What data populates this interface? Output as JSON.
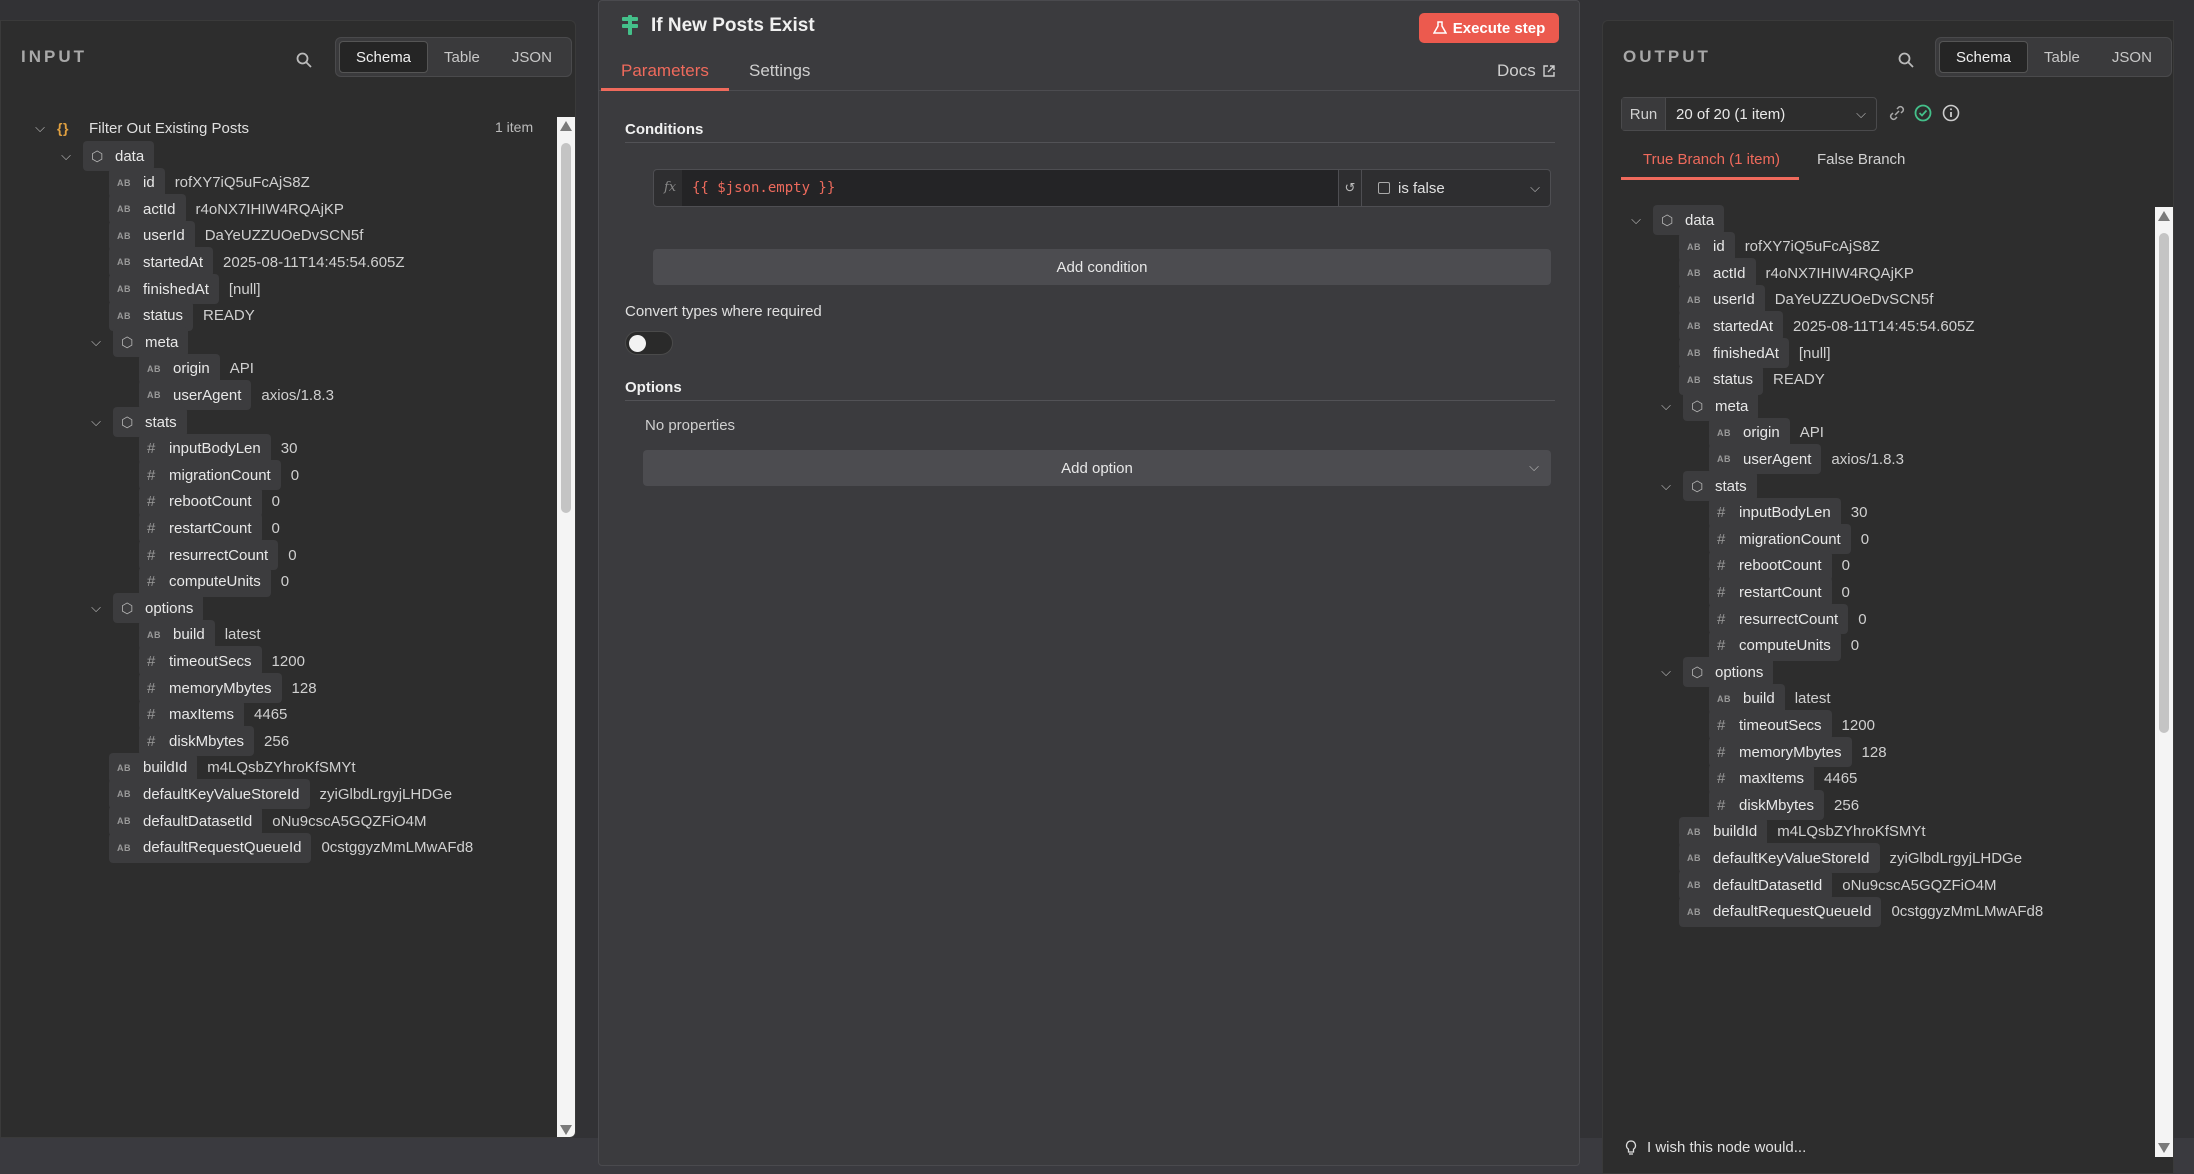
{
  "input": {
    "header": "INPUT",
    "tabs": [
      "Schema",
      "Table",
      "JSON"
    ],
    "root_title": "Filter Out Existing Posts",
    "root_count": "1 item"
  },
  "center": {
    "title": "If New Posts Exist",
    "execute_label": "Execute step",
    "tabs": [
      "Parameters",
      "Settings"
    ],
    "docs_label": "Docs",
    "conditions_label": "Conditions",
    "expression": "{{ $json.empty }}",
    "operator": "is false",
    "add_condition": "Add condition",
    "convert_label": "Convert types where required",
    "options_label": "Options",
    "no_properties": "No properties",
    "add_option": "Add option"
  },
  "output": {
    "header": "OUTPUT",
    "tabs": [
      "Schema",
      "Table",
      "JSON"
    ],
    "run_label": "Run",
    "run_value": "20 of 20 (1 item)",
    "branch_true": "True Branch (1 item)",
    "branch_false": "False Branch",
    "wish": "I wish this node would..."
  },
  "colors": {
    "accent": "#ef6a5c",
    "success": "#44c08a"
  },
  "tree": [
    {
      "d": 0,
      "t": "obj",
      "k": "data"
    },
    {
      "d": 1,
      "t": "str",
      "k": "id",
      "v": "rofXY7iQ5uFcAjS8Z"
    },
    {
      "d": 1,
      "t": "str",
      "k": "actId",
      "v": "r4oNX7IHIW4RQAjKP"
    },
    {
      "d": 1,
      "t": "str",
      "k": "userId",
      "v": "DaYeUZZUOeDvSCN5f"
    },
    {
      "d": 1,
      "t": "str",
      "k": "startedAt",
      "v": "2025-08-11T14:45:54.605Z"
    },
    {
      "d": 1,
      "t": "str",
      "k": "finishedAt",
      "v": "[null]"
    },
    {
      "d": 1,
      "t": "str",
      "k": "status",
      "v": "READY"
    },
    {
      "d": 1,
      "t": "obj",
      "k": "meta"
    },
    {
      "d": 2,
      "t": "str",
      "k": "origin",
      "v": "API"
    },
    {
      "d": 2,
      "t": "str",
      "k": "userAgent",
      "v": "axios/1.8.3"
    },
    {
      "d": 1,
      "t": "obj",
      "k": "stats"
    },
    {
      "d": 2,
      "t": "num",
      "k": "inputBodyLen",
      "v": "30"
    },
    {
      "d": 2,
      "t": "num",
      "k": "migrationCount",
      "v": "0"
    },
    {
      "d": 2,
      "t": "num",
      "k": "rebootCount",
      "v": "0"
    },
    {
      "d": 2,
      "t": "num",
      "k": "restartCount",
      "v": "0"
    },
    {
      "d": 2,
      "t": "num",
      "k": "resurrectCount",
      "v": "0"
    },
    {
      "d": 2,
      "t": "num",
      "k": "computeUnits",
      "v": "0"
    },
    {
      "d": 1,
      "t": "obj",
      "k": "options"
    },
    {
      "d": 2,
      "t": "str",
      "k": "build",
      "v": "latest"
    },
    {
      "d": 2,
      "t": "num",
      "k": "timeoutSecs",
      "v": "1200"
    },
    {
      "d": 2,
      "t": "num",
      "k": "memoryMbytes",
      "v": "128"
    },
    {
      "d": 2,
      "t": "num",
      "k": "maxItems",
      "v": "4465"
    },
    {
      "d": 2,
      "t": "num",
      "k": "diskMbytes",
      "v": "256"
    },
    {
      "d": 1,
      "t": "str",
      "k": "buildId",
      "v": "m4LQsbZYhroKfSMYt"
    },
    {
      "d": 1,
      "t": "str",
      "k": "defaultKeyValueStoreId",
      "v": "zyiGlbdLrgyjLHDGe"
    },
    {
      "d": 1,
      "t": "str",
      "k": "defaultDatasetId",
      "v": "oNu9cscA5GQZFiO4M"
    },
    {
      "d": 1,
      "t": "str",
      "k": "defaultRequestQueueId",
      "v": "0cstggyzMmLMwAFd8"
    }
  ]
}
